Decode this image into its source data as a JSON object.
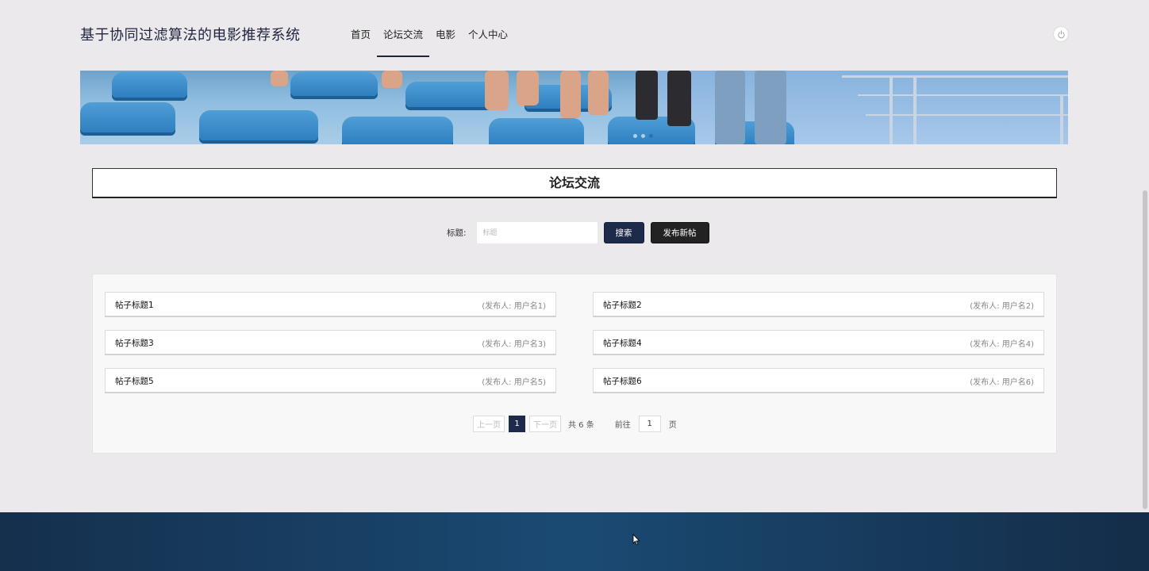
{
  "header": {
    "site_title": "基于协同过滤算法的电影推荐系统",
    "nav": [
      {
        "label": "首页",
        "active": false
      },
      {
        "label": "论坛交流",
        "active": true
      },
      {
        "label": "电影",
        "active": false
      },
      {
        "label": "个人中心",
        "active": false
      }
    ],
    "power_icon": "power-icon"
  },
  "banner": {
    "slide_count": 3,
    "active_slide": 3
  },
  "section": {
    "title": "论坛交流"
  },
  "search": {
    "label": "标题:",
    "placeholder": "标题",
    "value": "",
    "search_button": "搜索",
    "post_button": "发布新帖"
  },
  "posts": [
    {
      "title": "帖子标题1",
      "author": "(发布人:  用户名1)"
    },
    {
      "title": "帖子标题2",
      "author": "(发布人:  用户名2)"
    },
    {
      "title": "帖子标题3",
      "author": "(发布人:  用户名3)"
    },
    {
      "title": "帖子标题4",
      "author": "(发布人:  用户名4)"
    },
    {
      "title": "帖子标题5",
      "author": "(发布人:  用户名5)"
    },
    {
      "title": "帖子标题6",
      "author": "(发布人:  用户名6)"
    }
  ],
  "pagination": {
    "prev": "上一页",
    "current": "1",
    "next": "下一页",
    "total": "共 6 条",
    "goto_label": "前往",
    "goto_value": "1",
    "page_suffix": "页"
  },
  "colors": {
    "accent": "#1e2a4a",
    "page_bg": "#ebe9eb",
    "footer": "#1a4a73"
  }
}
